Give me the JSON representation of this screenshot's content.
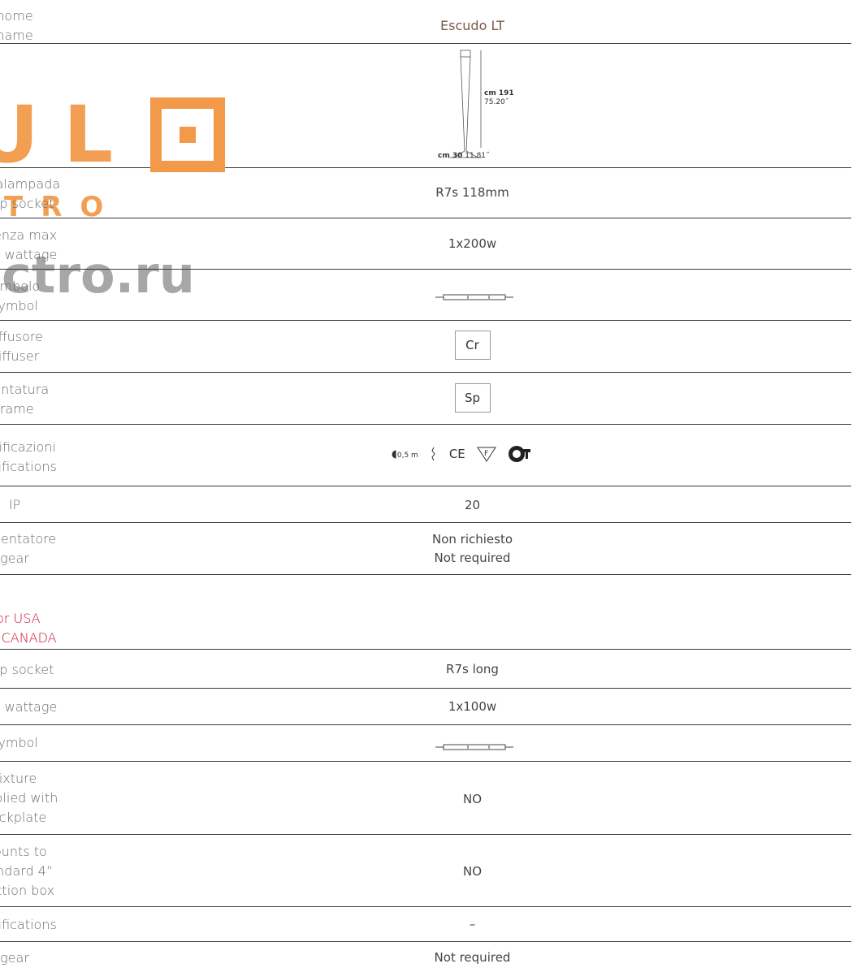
{
  "header": {
    "label_it": "nome",
    "label_en": "name",
    "value": "Escudo LT"
  },
  "drawing": {
    "height_label": "cm 191",
    "height_inches": "75.20˝",
    "base_label": "cm 30",
    "base_inches": "11.81˝"
  },
  "watermark": {
    "line1": "UL",
    "line2": "TRO",
    "line3": "ectro.ru"
  },
  "rows": [
    {
      "label_it": "portalampada",
      "label_en": "lamp socket",
      "value": "R7s 118mm"
    },
    {
      "label_it": "potenza max",
      "label_en": "max wattage",
      "value": "1x200w"
    },
    {
      "label_it": "simbolo",
      "label_en": "symbol",
      "value": ""
    },
    {
      "label_it": "diffusore",
      "label_en": "diffuser",
      "value": "Cr"
    },
    {
      "label_it": "montatura",
      "label_en": "frame",
      "value": "Sp"
    },
    {
      "label_it": "certificazioni",
      "label_en": "certifications",
      "value": "0,5 m"
    },
    {
      "label_it": "IP",
      "label_en": "",
      "value": "20"
    },
    {
      "label_it": "alimentatore",
      "label_en": "gear",
      "value_it": "Non richiesto",
      "value_en": "Not required"
    }
  ],
  "usa_section": {
    "title_line1": "For USA",
    "title_line2": "and CANADA",
    "rows": [
      {
        "label": "lamp socket",
        "value": "R7s long"
      },
      {
        "label": "max wattage",
        "value": "1x100w"
      },
      {
        "label": "symbol",
        "value": ""
      },
      {
        "label_lines": [
          "Fixture",
          "supplied with",
          "backplate"
        ],
        "value": "NO"
      },
      {
        "label_lines": [
          "Mounts to",
          "standard 4”",
          "junction box"
        ],
        "value": "NO"
      },
      {
        "label": "certifications",
        "value": "–"
      },
      {
        "label": "gear",
        "value": "Not required"
      }
    ]
  },
  "colors": {
    "accent_red": "#c8102e",
    "title_brown": "#7a5a4a",
    "watermark_orange": "#f29a4a"
  }
}
